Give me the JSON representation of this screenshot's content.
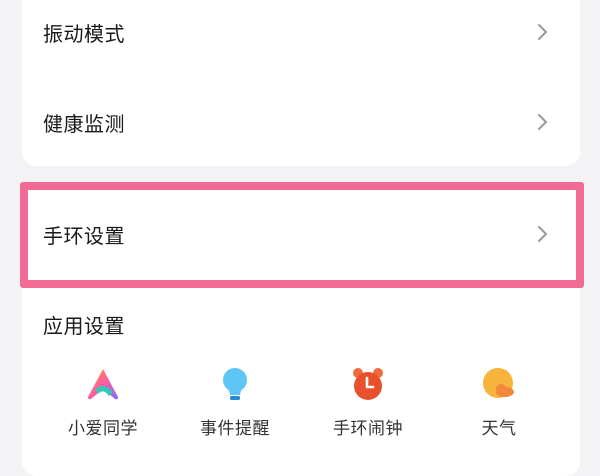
{
  "settings": {
    "vibration_mode": "振动模式",
    "health_monitor": "健康监测",
    "band_settings": "手环设置"
  },
  "app_settings": {
    "title": "应用设置",
    "apps": [
      {
        "label": "小爱同学",
        "icon": "xiaoai-icon"
      },
      {
        "label": "事件提醒",
        "icon": "lightbulb-icon"
      },
      {
        "label": "手环闹钟",
        "icon": "alarm-clock-icon"
      },
      {
        "label": "天气",
        "icon": "weather-icon"
      }
    ]
  },
  "colors": {
    "highlight": "#f26b95",
    "chevron": "#9a9a9a",
    "background": "#f3f3f5"
  }
}
